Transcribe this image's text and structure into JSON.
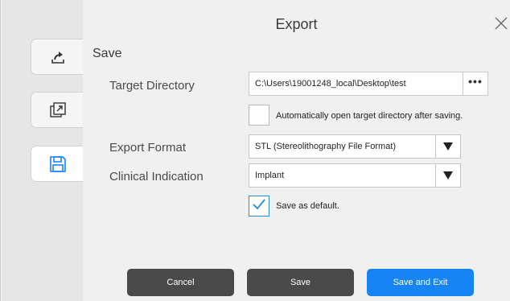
{
  "window": {
    "title": "Export",
    "close_icon": "close-icon"
  },
  "sidebar": {
    "tabs": [
      {
        "name": "export-share",
        "icon": "share-export-icon",
        "active": false
      },
      {
        "name": "export-window",
        "icon": "external-window-icon",
        "active": false
      },
      {
        "name": "save",
        "icon": "floppy-disk-icon",
        "active": true
      }
    ]
  },
  "section": {
    "title": "Save"
  },
  "form": {
    "target_directory": {
      "label": "Target Directory",
      "value": "C:\\Users\\19001248_local\\Desktop\\test",
      "browse_label": "•••"
    },
    "auto_open": {
      "label": "Automatically open target directory after saving.",
      "checked": false
    },
    "export_format": {
      "label": "Export Format",
      "value": "STL (Stereolithography File Format)"
    },
    "clinical_indication": {
      "label": "Clinical Indication",
      "value": "Implant"
    },
    "save_default": {
      "label": "Save as default.",
      "checked": true
    }
  },
  "buttons": {
    "cancel": "Cancel",
    "save": "Save",
    "save_and_exit": "Save and Exit"
  },
  "colors": {
    "accent": "#1684f5",
    "dark_button": "#4a4a4a",
    "checkbox_accent": "#2a8bd8"
  }
}
